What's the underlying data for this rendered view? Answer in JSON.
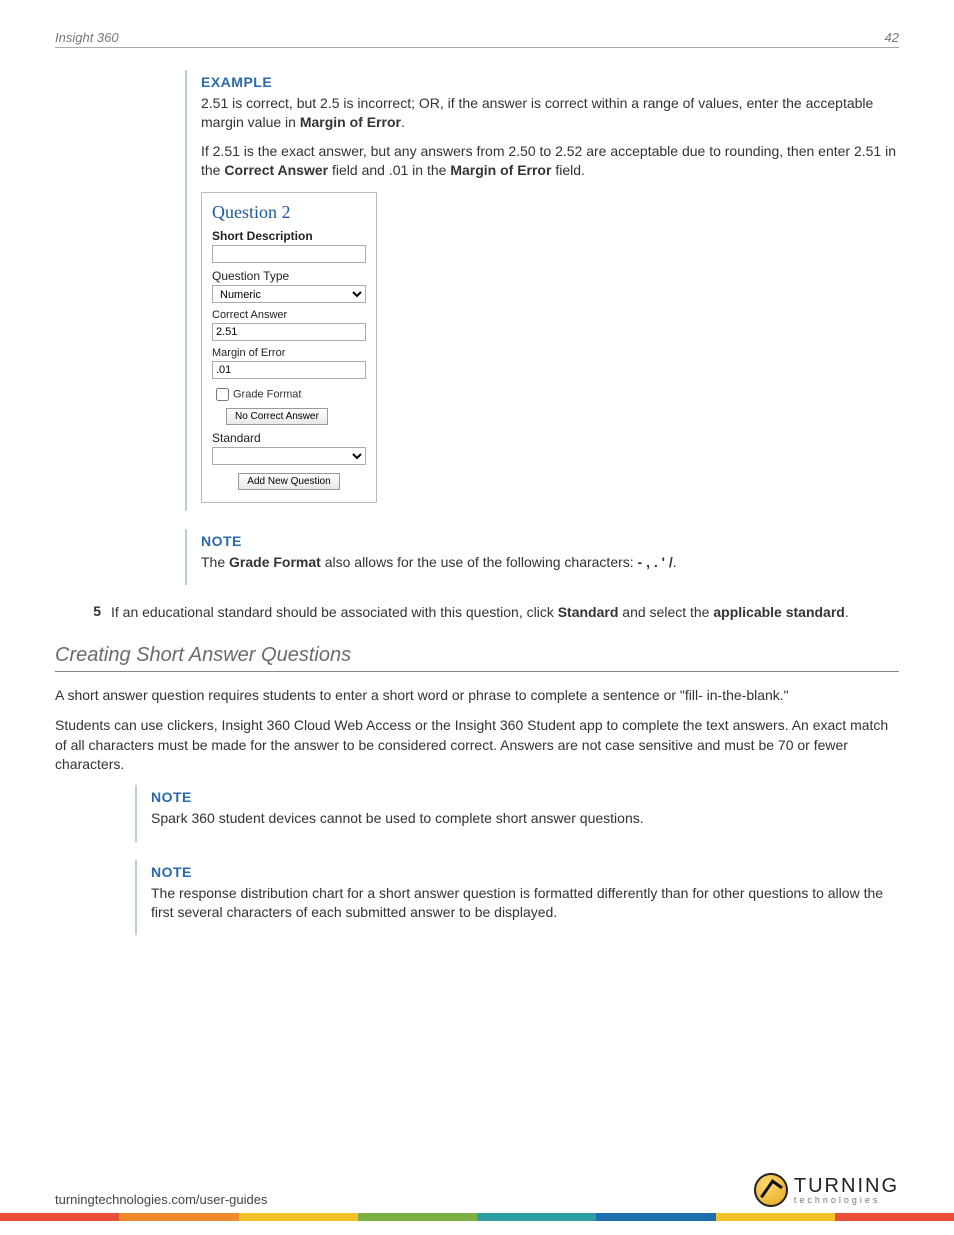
{
  "header": {
    "left": "Insight 360",
    "right": "42"
  },
  "example": {
    "title": "EXAMPLE",
    "p1_a": "2.51 is correct, but 2.5 is incorrect; OR, if the answer is correct within a range of values, enter the acceptable margin value in ",
    "p1_b": "Margin of Error",
    "p1_c": ".",
    "p2_a": "If 2.51 is the exact answer, but any answers from 2.50 to 2.52 are acceptable due to rounding, then enter 2.51 in the ",
    "p2_b": "Correct Answer",
    "p2_c": " field and .01 in the ",
    "p2_d": "Margin of Error",
    "p2_e": " field."
  },
  "qpanel": {
    "title": "Question 2",
    "short_desc_label": "Short Description",
    "short_desc_value": "",
    "qtype_label": "Question Type",
    "qtype_value": "Numeric",
    "correct_label": "Correct Answer",
    "correct_value": "2.51",
    "margin_label": "Margin of Error",
    "margin_value": ".01",
    "grade_format_label": "Grade Format",
    "no_correct_btn": "No Correct Answer",
    "standard_label": "Standard",
    "standard_value": "",
    "add_btn": "Add New Question"
  },
  "note1": {
    "title": "NOTE",
    "a": "The ",
    "b": "Grade Format",
    "c": " also allows for the use of the following characters: ",
    "d": "- , . ' /",
    "e": "."
  },
  "step5": {
    "num": "5",
    "a": "If an educational standard should be associated with this question, click ",
    "b": "Standard",
    "c": " and select the ",
    "d": "applicable standard",
    "e": "."
  },
  "section_heading": "Creating Short Answer Questions",
  "para1": "A short answer question requires students to enter a short word or phrase to complete a sentence or \"fill- in-the-blank.\"",
  "para2": "Students can use clickers, Insight 360 Cloud Web Access or the Insight 360 Student app to complete the text answers. An exact match of all characters must be made for the answer to be considered correct. Answers are not case sensitive and must be 70 or fewer characters.",
  "note2": {
    "title": "NOTE",
    "text": "Spark 360 student devices cannot be used to complete short answer questions."
  },
  "note3": {
    "title": "NOTE",
    "text": "The response distribution chart for a short answer question is formatted differently than for other questions to allow the first several characters of each submitted answer to be displayed."
  },
  "footer": {
    "url": "turningtechnologies.com/user-guides",
    "logo_top": "TURNING",
    "logo_bottom": "technologies"
  }
}
